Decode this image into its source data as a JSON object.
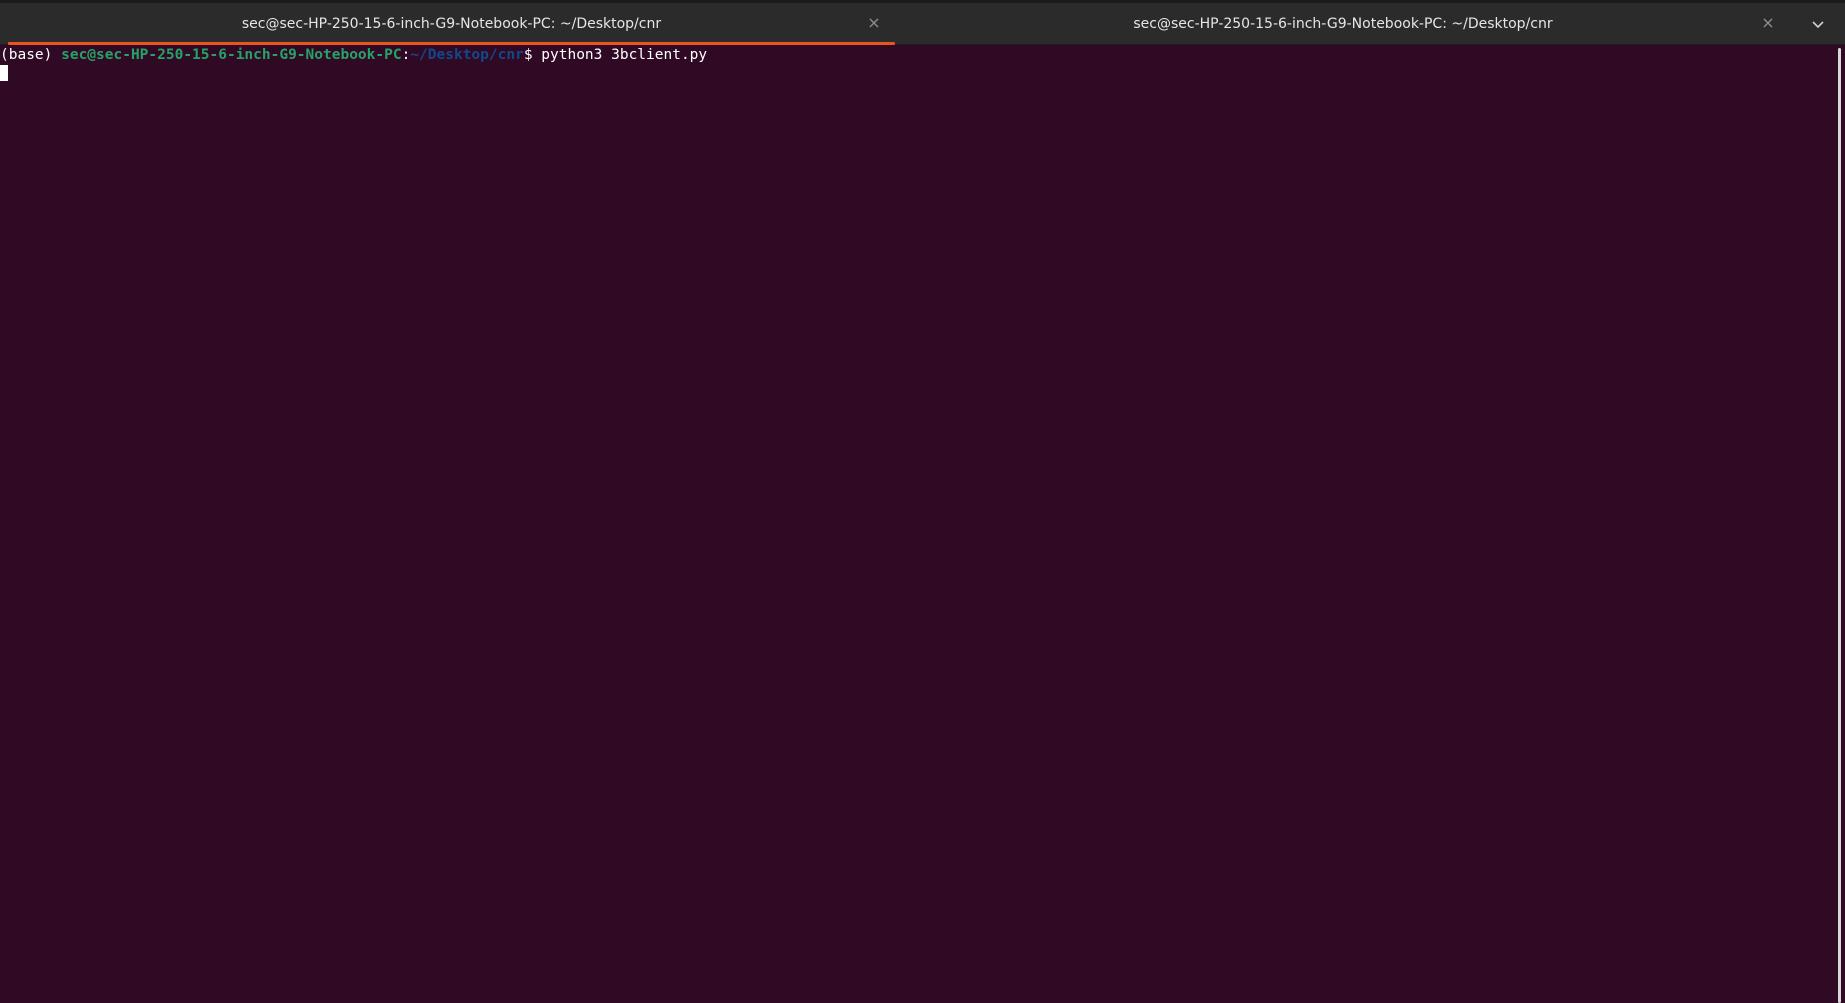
{
  "window": {
    "tabs": [
      {
        "title": "sec@sec-HP-250-15-6-inch-G9-Notebook-PC: ~/Desktop/cnr",
        "close_glyph": "×",
        "active": true
      },
      {
        "title": "sec@sec-HP-250-15-6-inch-G9-Notebook-PC: ~/Desktop/cnr",
        "close_glyph": "×",
        "active": false
      }
    ],
    "menu_icon": "chevron-down-icon"
  },
  "terminal": {
    "prompt": {
      "env": "(base) ",
      "user_host": "sec@sec-HP-250-15-6-inch-G9-Notebook-PC",
      "separator": ":",
      "path": "~/Desktop/cnr",
      "symbol": "$ ",
      "command": "python3 3bclient.py"
    }
  },
  "colors": {
    "background": "#300a24",
    "tabbar": "#2b2b2b",
    "accent": "#e95420",
    "user_host": "#26a269",
    "path": "#12488b",
    "text": "#ffffff"
  }
}
